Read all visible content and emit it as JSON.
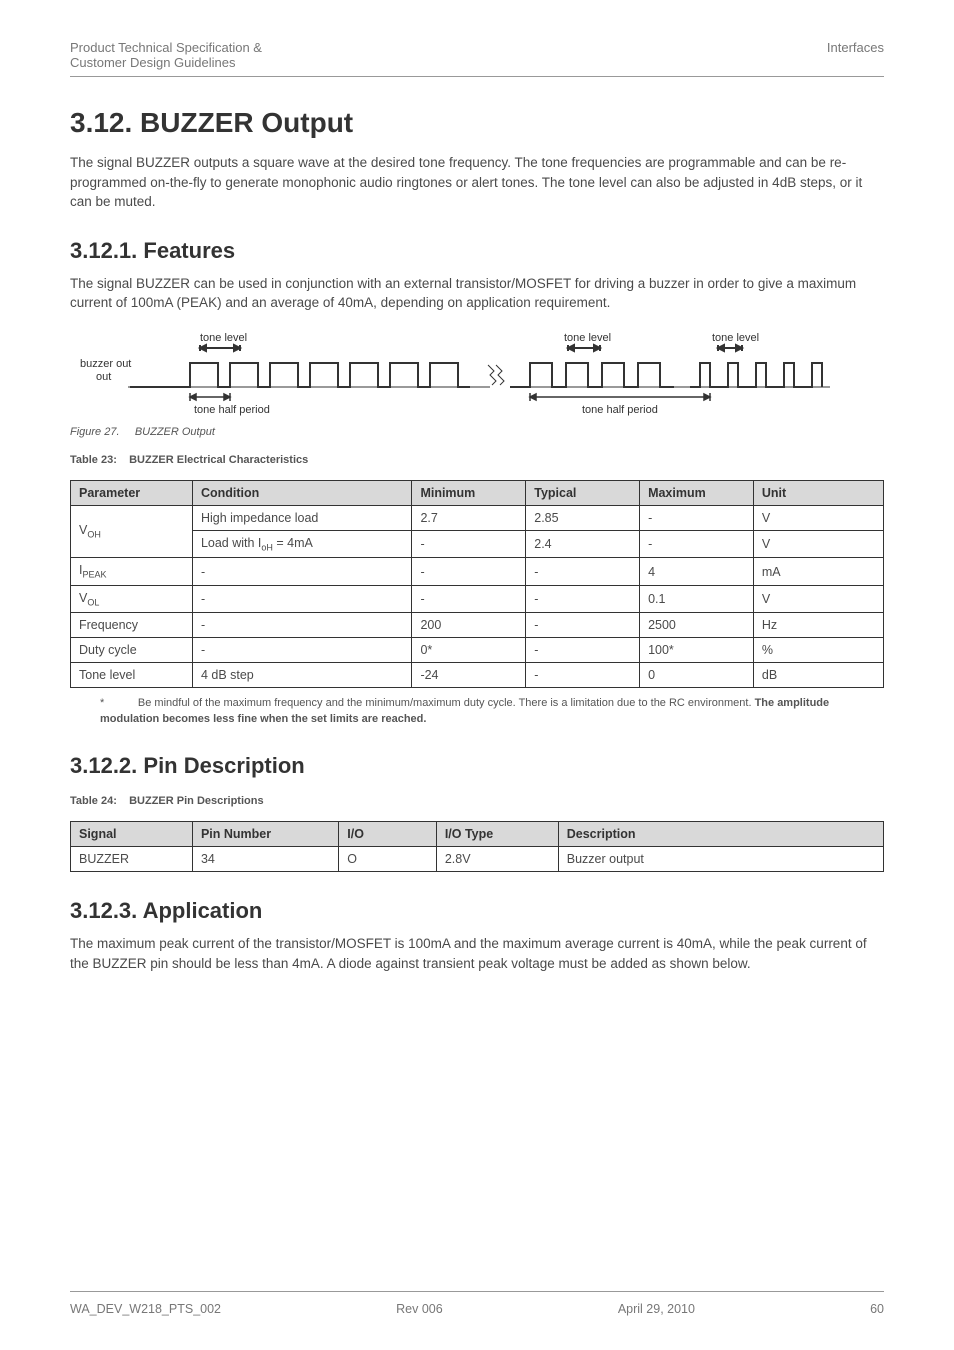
{
  "header": {
    "left_line1": "Product Technical Specification &",
    "left_line2": "Customer Design Guidelines",
    "right": "Interfaces"
  },
  "section": {
    "number_title": "3.12.   BUZZER Output",
    "intro": "The signal BUZZER outputs a square wave at the desired tone frequency. The tone frequencies are programmable and can be re-programmed on-the-fly to generate monophonic audio ringtones or alert tones.  The tone level can also be adjusted in 4dB steps, or it can be muted."
  },
  "features": {
    "title": "3.12.1.   Features",
    "body": "The signal BUZZER can be used in conjunction with an external transistor/MOSFET for driving a buzzer in order to give a maximum current of 100mA (PEAK) and an average of 40mA, depending on application requirement."
  },
  "figure": {
    "labels": {
      "y": "buzzer out",
      "tl1": "tone level",
      "tl2": "tone level",
      "tl3": "tone level",
      "thp1": "tone half period",
      "thp2": "tone half period"
    },
    "caption_label": "Figure 27.",
    "caption_text": "BUZZER Output"
  },
  "table23": {
    "caption_label": "Table 23:",
    "caption_text": "BUZZER Electrical Characteristics",
    "headers": [
      "Parameter",
      "Condition",
      "Minimum",
      "Typical",
      "Maximum",
      "Unit"
    ],
    "rows": [
      {
        "param_html": "V<sub>OH</sub>",
        "cond": "High impedance load",
        "min": "2.7",
        "typ": "2.85",
        "max": "-",
        "unit": "V"
      },
      {
        "param_html": "",
        "cond_html": "Load with I<sub>oH</sub> = 4mA",
        "min": "-",
        "typ": "2.4",
        "max": "-",
        "unit": "V"
      },
      {
        "param_html": "I<sub>PEAK</sub>",
        "cond": "-",
        "min": "-",
        "typ": "-",
        "max": "4",
        "unit": "mA"
      },
      {
        "param_html": "V<sub>OL</sub>",
        "cond": "-",
        "min": "-",
        "typ": "-",
        "max": "0.1",
        "unit": "V"
      },
      {
        "param": "Frequency",
        "cond": "-",
        "min": "200",
        "typ": "-",
        "max": "2500",
        "unit": "Hz"
      },
      {
        "param": "Duty cycle",
        "cond": "-",
        "min": "0*",
        "typ": "-",
        "max": "100*",
        "unit": "%"
      },
      {
        "param": "Tone level",
        "cond": "4 dB step",
        "min": "-24",
        "typ": "-",
        "max": "0",
        "unit": "dB"
      }
    ],
    "note_prefix": "*",
    "note_text": "Be mindful of the maximum frequency and the minimum/maximum duty cycle. There is a limitation due to the RC environment. ",
    "note_bold": "The amplitude modulation becomes less fine when the set limits are reached."
  },
  "pindesc": {
    "title": "3.12.2.   Pin Description",
    "caption_label": "Table 24:",
    "caption_text": "BUZZER Pin Descriptions",
    "headers": [
      "Signal",
      "Pin Number",
      "I/O",
      "I/O Type",
      "Description"
    ],
    "row": {
      "signal": "BUZZER",
      "pin": "34",
      "io": "O",
      "iotype": "2.8V",
      "desc": "Buzzer output"
    }
  },
  "app": {
    "title": "3.12.3.   Application",
    "body": "The maximum peak current of the transistor/MOSFET is 100mA and the maximum average current is 40mA, while the peak current of the BUZZER pin should be less than 4mA. A diode against transient peak voltage must be added as shown below."
  },
  "footer": {
    "left": "WA_DEV_W218_PTS_002",
    "center": "Rev 006",
    "right_date": "April 29, 2010",
    "page": "60"
  }
}
